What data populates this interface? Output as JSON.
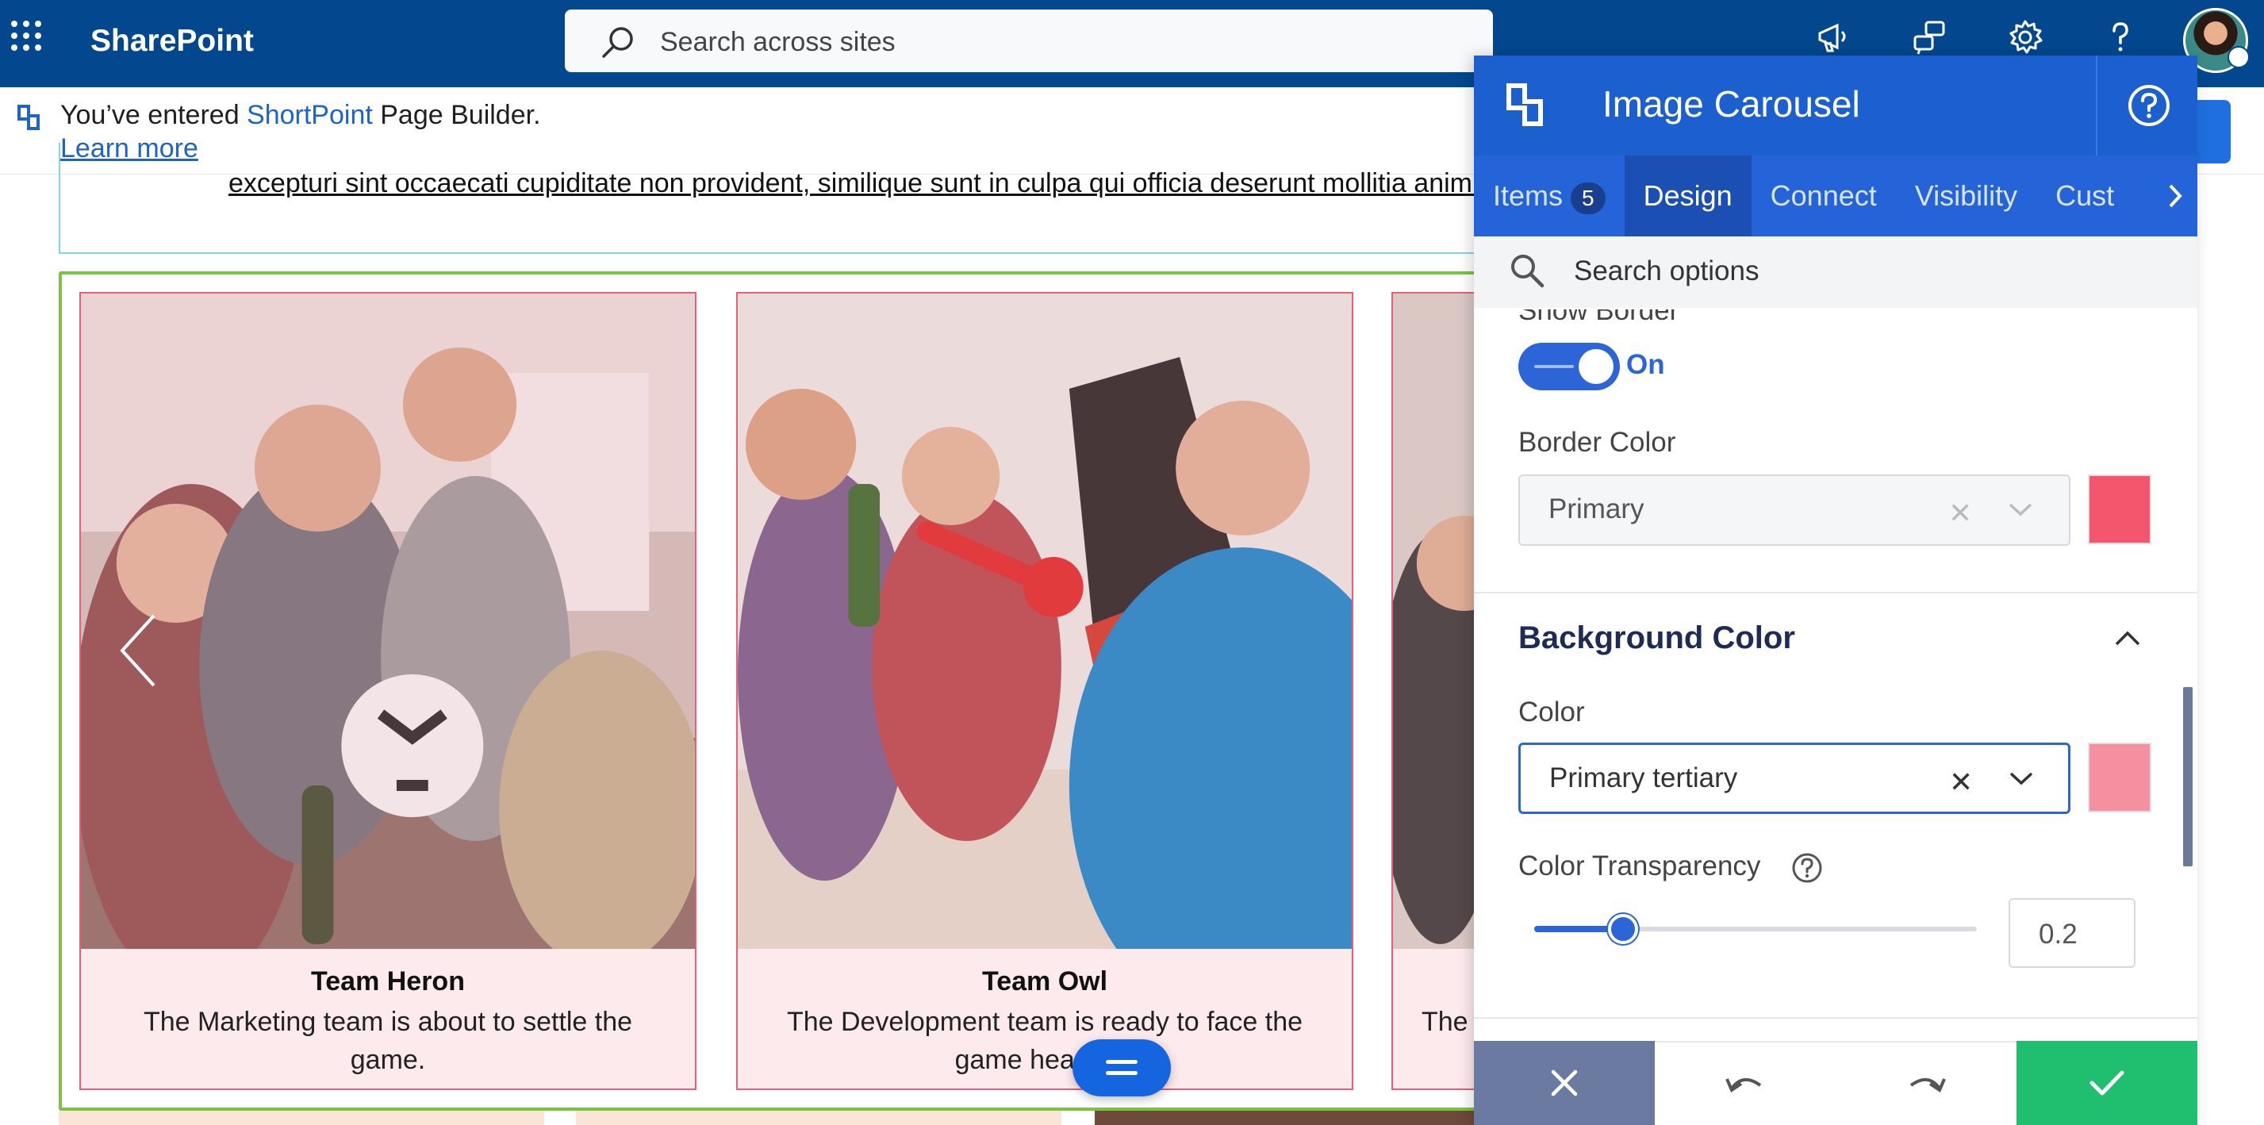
{
  "suite_bar": {
    "app_name": "SharePoint",
    "search_placeholder": "Search across sites",
    "icons": [
      "app-launcher-icon",
      "megaphone-icon",
      "community-icon",
      "gear-icon",
      "help-icon"
    ]
  },
  "notice": {
    "prefix": "You’ve entered ",
    "product": "ShortPoint",
    "middle": " Page Builder. ",
    "link": "Learn more"
  },
  "page": {
    "text_line": "excepturi sint occaecati cupiditate non provident, similique sunt in culpa qui officia deserunt mollitia animi, id est laborum et dolorum fuga.",
    "cards": [
      {
        "title": "Team Heron",
        "description": "The Marketing team is about to settle the game."
      },
      {
        "title": "Team Owl",
        "description": "The Development team is ready to face the game head on."
      },
      {
        "title": "",
        "description": "The"
      }
    ]
  },
  "panel": {
    "title": "Image Carousel",
    "tabs": [
      {
        "label": "Items",
        "badge": "5"
      },
      {
        "label": "Design"
      },
      {
        "label": "Connect"
      },
      {
        "label": "Visibility"
      },
      {
        "label": "Cust"
      }
    ],
    "search_placeholder": "Search options",
    "show_border": {
      "label": "Show Border",
      "state": "On"
    },
    "border_color": {
      "label": "Border Color",
      "value": "Primary",
      "swatch": "#f4566e"
    },
    "background_section": {
      "title": "Background Color",
      "color_label": "Color",
      "color_value": "Primary tertiary",
      "swatch": "#f590a1",
      "transparency_label": "Color Transparency",
      "transparency_value": "0.2"
    }
  },
  "colors": {
    "suite_bar": "#03488f",
    "panel_header": "#1c5fcf",
    "accent": "#2b65d8",
    "card_border": "#e6607a",
    "carousel_border": "#7cc242",
    "confirm": "#1fbf6f",
    "cancel": "#6a7aa0"
  }
}
